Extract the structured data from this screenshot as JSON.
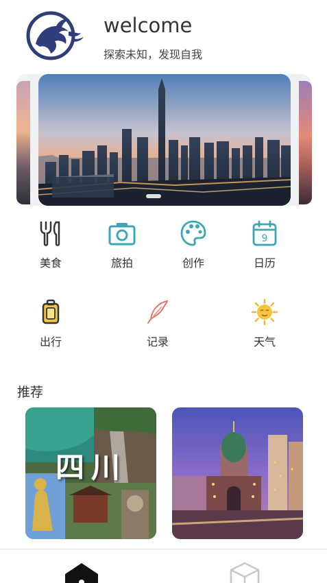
{
  "header": {
    "title": "welcome",
    "subtitle": "探索未知，发现自我",
    "logo_icon": "dragon-logo-icon"
  },
  "carousel": {
    "image": "city-skyline-sunset",
    "active_index": 1
  },
  "grid": {
    "row1": [
      {
        "label": "美食",
        "icon": "food-icon"
      },
      {
        "label": "旅拍",
        "icon": "camera-icon"
      },
      {
        "label": "创作",
        "icon": "palette-icon"
      },
      {
        "label": "日历",
        "icon": "calendar-icon",
        "calendar_day": "9"
      }
    ],
    "row2": [
      {
        "label": "出行",
        "icon": "luggage-icon"
      },
      {
        "label": "记录",
        "icon": "feather-icon"
      },
      {
        "label": "天气",
        "icon": "sun-icon"
      }
    ]
  },
  "recommend": {
    "title": "推荐",
    "cards": [
      {
        "image": "sichuan-scenery",
        "overlay_text": "四川"
      },
      {
        "image": "cathedral-night"
      }
    ]
  },
  "tabbar": {
    "tabs": [
      {
        "icon": "home-icon",
        "active": true
      },
      {
        "icon": "cube-icon",
        "active": false
      }
    ]
  },
  "colors": {
    "accent_teal": "#3aa6b4",
    "logo_navy": "#2f3e7a",
    "text_dark": "#333333"
  }
}
